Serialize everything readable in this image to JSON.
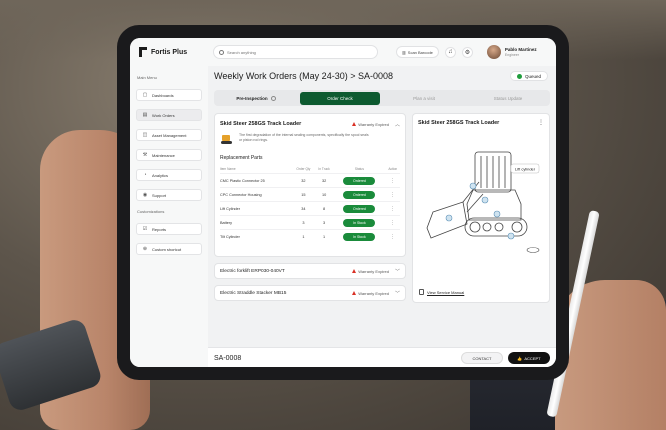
{
  "app": {
    "brand": "Fortis Plus"
  },
  "search": {
    "placeholder": "Search anything"
  },
  "topbar": {
    "scan_label": "Scan Barcode",
    "user_name": "Pablo Martinez",
    "user_role": "Engineer"
  },
  "sidebar": {
    "main_menu_label": "Main Menu",
    "items": [
      {
        "label": "Dashboards",
        "icon": "dashboard-icon"
      },
      {
        "label": "Work Orders",
        "icon": "clipboard-icon"
      },
      {
        "label": "Asset Management",
        "icon": "asset-icon"
      },
      {
        "label": "Maintenance",
        "icon": "wrench-icon"
      },
      {
        "label": "Analytics",
        "icon": "chart-icon"
      },
      {
        "label": "Support",
        "icon": "support-icon"
      }
    ],
    "customizations_label": "Customizations",
    "custom_items": [
      {
        "label": "Reports",
        "icon": "check-icon"
      },
      {
        "label": "Custom shortcut",
        "icon": "plus-icon"
      }
    ]
  },
  "header": {
    "title": "Weekly Work Orders (May 24-30)",
    "separator": ">",
    "order_id": "SA-0008",
    "status": "Queued",
    "status_color": "#1f9d3c"
  },
  "steps": [
    {
      "label": "Pre-Inspection",
      "state": "done"
    },
    {
      "label": "Order Check",
      "state": "current"
    },
    {
      "label": "Plan a visit",
      "state": "pending"
    },
    {
      "label": "Status Update",
      "state": "pending"
    }
  ],
  "main_card": {
    "title": "Skid Steer 258GS Track Loader",
    "warranty": "Warranty Expired",
    "description": "The first degradation of the internal sealing components, specifically the spool seals or piston rod rings.",
    "parts_title": "Replacement Parts",
    "columns": [
      "Item Name",
      "Order Qty",
      "In Truck",
      "Status",
      "Action"
    ],
    "rows": [
      {
        "name": "CMC Plastic Connector 25",
        "qty": "32",
        "truck": "32",
        "status": "Ordered"
      },
      {
        "name": "CPC Connector Housing",
        "qty": "15",
        "truck": "10",
        "status": "Ordered"
      },
      {
        "name": "Lift Cylinder",
        "qty": "34",
        "truck": "8",
        "status": "Ordered"
      },
      {
        "name": "Battery",
        "qty": "3",
        "truck": "3",
        "status": "In Stock"
      },
      {
        "name": "Tilt Cylinder",
        "qty": "1",
        "truck": "1",
        "status": "In Stock"
      }
    ],
    "status_color": "#1a8b3b"
  },
  "collapsed_cards": [
    {
      "title": "Electric forklift ERP030-040VT",
      "warranty": "Warranty Expired"
    },
    {
      "title": "Electric Straddle Stacker MB15",
      "warranty": "Warranty Expired"
    }
  ],
  "right_panel": {
    "title": "Skid Steer 258GS Track Loader",
    "callout": "Lift cylinder",
    "manual_link": "View Service Manual"
  },
  "bottombar": {
    "order_code": "SA-0008",
    "contact_label": "CONTACT",
    "accept_label": "ACCEPT"
  }
}
